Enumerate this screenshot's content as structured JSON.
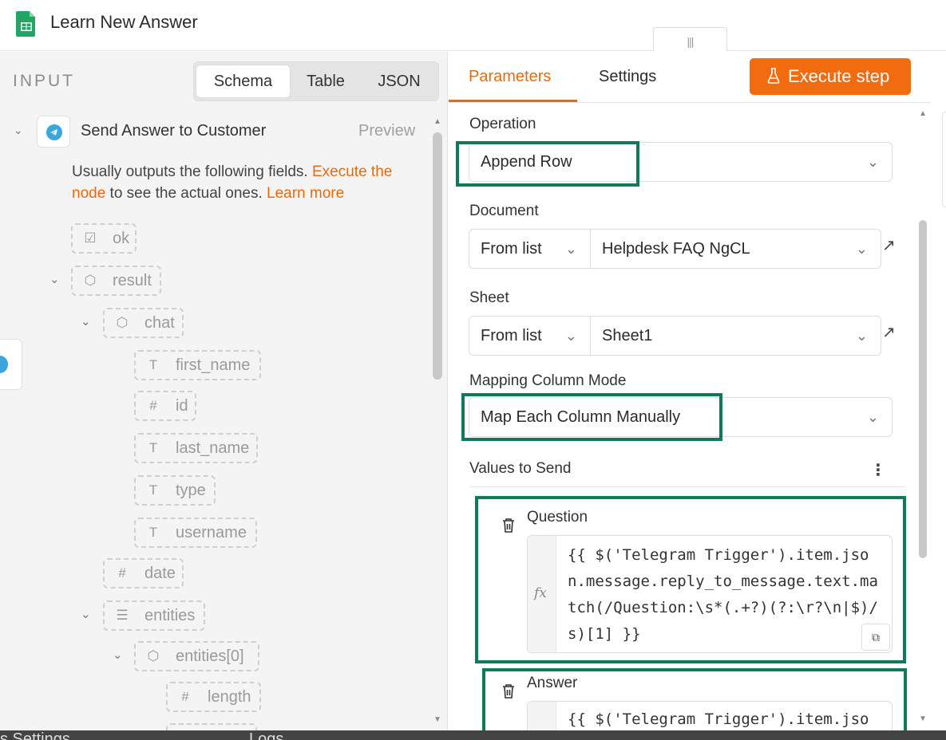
{
  "window": {
    "title": "Learn New Answer"
  },
  "background": {
    "left_text": "s  Settings",
    "right_text": "Logs"
  },
  "input_panel": {
    "label": "INPUT",
    "view_tabs": [
      "Schema",
      "Table",
      "JSON"
    ],
    "active_view": "Schema",
    "node": {
      "name": "Send Answer to Customer",
      "preview_label": "Preview",
      "desc_before": "Usually outputs the following fields. ",
      "execute_link": "Execute the node",
      "desc_middle": " to see the actual ones. ",
      "learn_link": "Learn more"
    },
    "schema_fields": [
      {
        "key": "ok",
        "type_icon": "☑"
      },
      {
        "key": "result",
        "type_icon": "⬡"
      },
      {
        "key": "chat",
        "type_icon": "⬡"
      },
      {
        "key": "first_name",
        "type_icon": "T"
      },
      {
        "key": "id",
        "type_icon": "#"
      },
      {
        "key": "last_name",
        "type_icon": "T"
      },
      {
        "key": "type",
        "type_icon": "T"
      },
      {
        "key": "username",
        "type_icon": "T"
      },
      {
        "key": "date",
        "type_icon": "#"
      },
      {
        "key": "entities",
        "type_icon": "☰"
      },
      {
        "key": "entities[0]",
        "type_icon": "⬡"
      },
      {
        "key": "length",
        "type_icon": "#"
      }
    ]
  },
  "params_panel": {
    "tabs": [
      "Parameters",
      "Settings"
    ],
    "active_tab": "Parameters",
    "execute_button": "Execute step",
    "operation": {
      "label": "Operation",
      "value": "Append Row"
    },
    "document": {
      "label": "Document",
      "mode": "From list",
      "value": "Helpdesk FAQ NgCL"
    },
    "sheet": {
      "label": "Sheet",
      "mode": "From list",
      "value": "Sheet1"
    },
    "mapping": {
      "label": "Mapping Column Mode",
      "value": "Map Each Column Manually"
    },
    "values_to_send": {
      "label": "Values to Send",
      "items": [
        {
          "column": "Question",
          "expression": "{{ $('Telegram Trigger').item.json.message.reply_to_message.text.match(/Question:\\s*(.+?)(?:\\r?\\n|$)/s)[1] }}"
        },
        {
          "column": "Answer",
          "expression": "{{ $('Telegram Trigger').item.jso"
        }
      ]
    }
  },
  "colors": {
    "accent": "#ea6a0a",
    "highlight": "#0e7a5b",
    "telegram": "#3aa6dc",
    "sheets": "#23a566"
  },
  "icons": [
    "google-sheets-icon",
    "telegram-icon",
    "flask-icon",
    "chevron-down-icon",
    "external-link-icon",
    "trash-icon",
    "kebab-menu-icon",
    "fx-icon",
    "expand-icon",
    "drag-handle-icon"
  ]
}
